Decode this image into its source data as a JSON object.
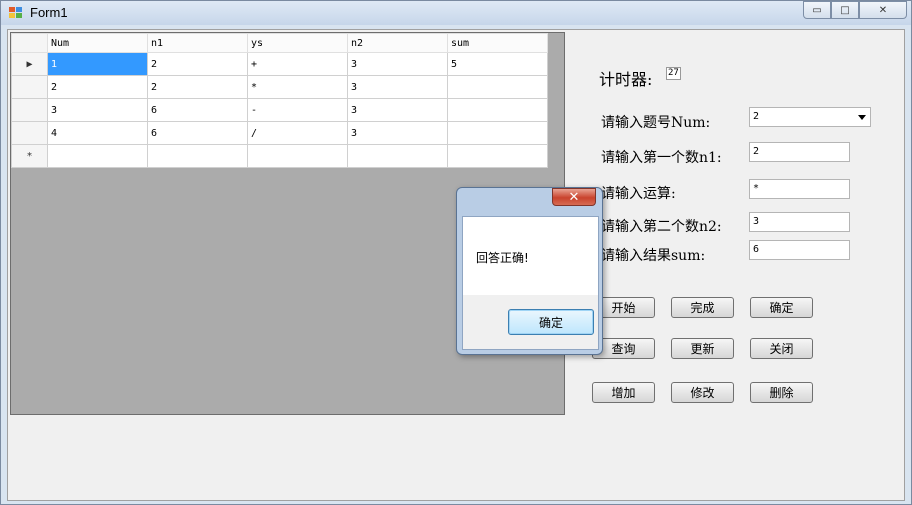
{
  "window": {
    "title": "Form1",
    "icon": "form-app-icon",
    "controls": {
      "minimize": "▭",
      "maximize": "□",
      "close": "✕"
    }
  },
  "grid": {
    "columns": [
      "Num",
      "n1",
      "ys",
      "n2",
      "sum"
    ],
    "rows": [
      {
        "marker": "▶",
        "cells": [
          "1",
          "2",
          "+",
          "3",
          "5"
        ]
      },
      {
        "marker": "",
        "cells": [
          "2",
          "2",
          "*",
          "3",
          ""
        ]
      },
      {
        "marker": "",
        "cells": [
          "3",
          "6",
          "-",
          "3",
          ""
        ]
      },
      {
        "marker": "",
        "cells": [
          "4",
          "6",
          "/",
          "3",
          ""
        ]
      },
      {
        "marker": "*",
        "cells": [
          "",
          "",
          "",
          "",
          ""
        ]
      }
    ]
  },
  "form": {
    "timer_label": "计时器:",
    "timer_value": "27",
    "num_label": "请输入题号Num:",
    "num_value": "2",
    "n1_label": "请输入第一个数n1:",
    "n1_value": "2",
    "op_label": "请输入运算:",
    "op_value": "*",
    "n2_label": "请输入第二个数n2:",
    "n2_value": "3",
    "sum_label": "请输入结果sum:",
    "sum_value": "6"
  },
  "buttons": {
    "start": "开始",
    "finish": "完成",
    "confirm": "确定",
    "query": "查询",
    "update": "更新",
    "close": "关闭",
    "add": "增加",
    "modify": "修改",
    "delete": "删除"
  },
  "messagebox": {
    "text": "回答正确!",
    "ok": "确定",
    "close": "✕"
  },
  "colors": {
    "selection": "#3399ff",
    "grid_background": "#ababab",
    "client_background": "#f0f0f0"
  }
}
